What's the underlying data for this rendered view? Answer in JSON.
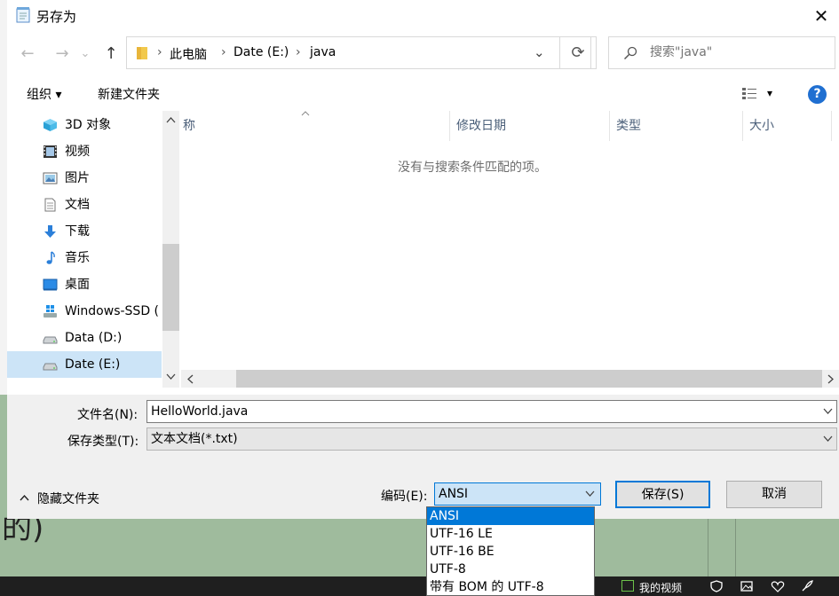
{
  "window": {
    "title": "另存为",
    "close": "✕"
  },
  "nav": {
    "back": "←",
    "forward": "→",
    "recent": "⌄",
    "up": "↑"
  },
  "address": {
    "crumbs": [
      "此电脑",
      "Date (E:)",
      "java"
    ],
    "separator": "›",
    "dropdown": "⌄"
  },
  "refresh": "⟳",
  "search": {
    "placeholder": "搜索\"java\""
  },
  "toolbar": {
    "organize": "组织 ▾",
    "new_folder": "新建文件夹",
    "view": "▾",
    "help": "?"
  },
  "sidebar": {
    "items": [
      {
        "label": "3D 对象",
        "icon": "cube-icon"
      },
      {
        "label": "视频",
        "icon": "video-icon"
      },
      {
        "label": "图片",
        "icon": "picture-icon"
      },
      {
        "label": "文档",
        "icon": "document-icon"
      },
      {
        "label": "下载",
        "icon": "download-icon"
      },
      {
        "label": "音乐",
        "icon": "music-icon"
      },
      {
        "label": "桌面",
        "icon": "desktop-icon"
      },
      {
        "label": "Windows-SSD (",
        "icon": "windows-drive-icon"
      },
      {
        "label": "Data (D:)",
        "icon": "drive-icon"
      },
      {
        "label": "Date (E:)",
        "icon": "drive-icon",
        "selected": true
      }
    ]
  },
  "columns": {
    "name": "称",
    "modified": "修改日期",
    "type": "类型",
    "size": "大小"
  },
  "empty_message": "没有与搜索条件匹配的项。",
  "form": {
    "filename_label": "文件名(N):",
    "filename_value": "HelloWorld.java",
    "filetype_label": "保存类型(T):",
    "filetype_value": "文本文档(*.txt)",
    "hide_folders": "隐藏文件夹",
    "encoding_label": "编码(E):",
    "encoding_value": "ANSI",
    "save": "保存(S)",
    "cancel": "取消"
  },
  "encoding_options": [
    "ANSI",
    "UTF-16 LE",
    "UTF-16 BE",
    "UTF-8",
    "带有 BOM 的 UTF-8"
  ],
  "background": {
    "glyph": "的)",
    "taskbar_item": "我的视频"
  },
  "colors": {
    "accent": "#0078d7",
    "selection": "#cce4f7",
    "help": "#1f6fd1",
    "background_app": "#9fbc9e"
  }
}
